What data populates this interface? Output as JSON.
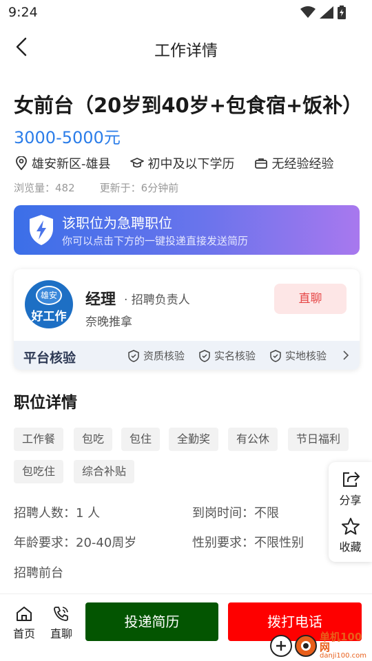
{
  "status_bar": {
    "time": "9:24",
    "icons": [
      "wifi-icon",
      "signal-icon",
      "battery-charging-icon"
    ]
  },
  "nav": {
    "title": "工作详情",
    "back_icon": "chevron-left-icon"
  },
  "job": {
    "title": "女前台（20岁到40岁+包食宿+饭补）",
    "salary": "3000-5000元",
    "location": "雄安新区-雄县",
    "education": "初中及以下学历",
    "experience": "无经验经验",
    "views_label": "浏览量：",
    "views": "482",
    "updated_label": "更新于：",
    "updated": "6分钟前"
  },
  "urgent": {
    "title": "该职位为急聘职位",
    "subtitle": "你可以点击下方的一键投递直接发送简历",
    "colors": {
      "start": "#3b6fe8",
      "end": "#a878ee"
    }
  },
  "recruiter": {
    "avatar_top": "雄安",
    "avatar_bottom": "好工作",
    "name": "经理",
    "role": "· 招聘负责人",
    "company": "奈晚推拿",
    "chat_label": "直聊",
    "verify_title": "平台核验",
    "verify_items": [
      "资质核验",
      "实名核验",
      "实地核验"
    ]
  },
  "details": {
    "section_title": "职位详情",
    "tags": [
      "工作餐",
      "包吃",
      "包住",
      "全勤奖",
      "有公休",
      "节日福利",
      "包吃住",
      "综合补贴"
    ],
    "headcount_label": "招聘人数：",
    "headcount": "1 人",
    "start_label": "到岗时间：",
    "start": "不限",
    "age_label": "年龄要求：",
    "age": "20-40周岁",
    "gender_label": "性别要求：",
    "gender": "不限性别",
    "description": "招聘前台"
  },
  "float_panel": {
    "share": "分享",
    "favorite": "收藏"
  },
  "bottom": {
    "home": "首页",
    "chat": "直聊",
    "apply": "投递简历",
    "call": "拨打电话",
    "colors": {
      "apply": "#035501",
      "call": "#fe0000"
    }
  },
  "watermark": {
    "top": "单机100网",
    "bottom": "danji100.com"
  }
}
